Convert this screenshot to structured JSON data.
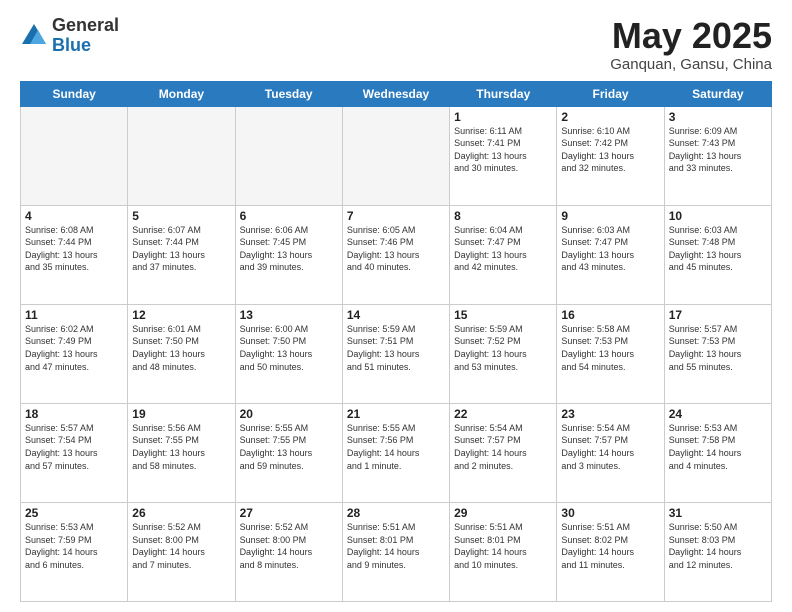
{
  "logo": {
    "general": "General",
    "blue": "Blue"
  },
  "title": "May 2025",
  "location": "Ganquan, Gansu, China",
  "days_of_week": [
    "Sunday",
    "Monday",
    "Tuesday",
    "Wednesday",
    "Thursday",
    "Friday",
    "Saturday"
  ],
  "weeks": [
    [
      {
        "day": "",
        "info": ""
      },
      {
        "day": "",
        "info": ""
      },
      {
        "day": "",
        "info": ""
      },
      {
        "day": "",
        "info": ""
      },
      {
        "day": "1",
        "info": "Sunrise: 6:11 AM\nSunset: 7:41 PM\nDaylight: 13 hours\nand 30 minutes."
      },
      {
        "day": "2",
        "info": "Sunrise: 6:10 AM\nSunset: 7:42 PM\nDaylight: 13 hours\nand 32 minutes."
      },
      {
        "day": "3",
        "info": "Sunrise: 6:09 AM\nSunset: 7:43 PM\nDaylight: 13 hours\nand 33 minutes."
      }
    ],
    [
      {
        "day": "4",
        "info": "Sunrise: 6:08 AM\nSunset: 7:44 PM\nDaylight: 13 hours\nand 35 minutes."
      },
      {
        "day": "5",
        "info": "Sunrise: 6:07 AM\nSunset: 7:44 PM\nDaylight: 13 hours\nand 37 minutes."
      },
      {
        "day": "6",
        "info": "Sunrise: 6:06 AM\nSunset: 7:45 PM\nDaylight: 13 hours\nand 39 minutes."
      },
      {
        "day": "7",
        "info": "Sunrise: 6:05 AM\nSunset: 7:46 PM\nDaylight: 13 hours\nand 40 minutes."
      },
      {
        "day": "8",
        "info": "Sunrise: 6:04 AM\nSunset: 7:47 PM\nDaylight: 13 hours\nand 42 minutes."
      },
      {
        "day": "9",
        "info": "Sunrise: 6:03 AM\nSunset: 7:47 PM\nDaylight: 13 hours\nand 43 minutes."
      },
      {
        "day": "10",
        "info": "Sunrise: 6:03 AM\nSunset: 7:48 PM\nDaylight: 13 hours\nand 45 minutes."
      }
    ],
    [
      {
        "day": "11",
        "info": "Sunrise: 6:02 AM\nSunset: 7:49 PM\nDaylight: 13 hours\nand 47 minutes."
      },
      {
        "day": "12",
        "info": "Sunrise: 6:01 AM\nSunset: 7:50 PM\nDaylight: 13 hours\nand 48 minutes."
      },
      {
        "day": "13",
        "info": "Sunrise: 6:00 AM\nSunset: 7:50 PM\nDaylight: 13 hours\nand 50 minutes."
      },
      {
        "day": "14",
        "info": "Sunrise: 5:59 AM\nSunset: 7:51 PM\nDaylight: 13 hours\nand 51 minutes."
      },
      {
        "day": "15",
        "info": "Sunrise: 5:59 AM\nSunset: 7:52 PM\nDaylight: 13 hours\nand 53 minutes."
      },
      {
        "day": "16",
        "info": "Sunrise: 5:58 AM\nSunset: 7:53 PM\nDaylight: 13 hours\nand 54 minutes."
      },
      {
        "day": "17",
        "info": "Sunrise: 5:57 AM\nSunset: 7:53 PM\nDaylight: 13 hours\nand 55 minutes."
      }
    ],
    [
      {
        "day": "18",
        "info": "Sunrise: 5:57 AM\nSunset: 7:54 PM\nDaylight: 13 hours\nand 57 minutes."
      },
      {
        "day": "19",
        "info": "Sunrise: 5:56 AM\nSunset: 7:55 PM\nDaylight: 13 hours\nand 58 minutes."
      },
      {
        "day": "20",
        "info": "Sunrise: 5:55 AM\nSunset: 7:55 PM\nDaylight: 13 hours\nand 59 minutes."
      },
      {
        "day": "21",
        "info": "Sunrise: 5:55 AM\nSunset: 7:56 PM\nDaylight: 14 hours\nand 1 minute."
      },
      {
        "day": "22",
        "info": "Sunrise: 5:54 AM\nSunset: 7:57 PM\nDaylight: 14 hours\nand 2 minutes."
      },
      {
        "day": "23",
        "info": "Sunrise: 5:54 AM\nSunset: 7:57 PM\nDaylight: 14 hours\nand 3 minutes."
      },
      {
        "day": "24",
        "info": "Sunrise: 5:53 AM\nSunset: 7:58 PM\nDaylight: 14 hours\nand 4 minutes."
      }
    ],
    [
      {
        "day": "25",
        "info": "Sunrise: 5:53 AM\nSunset: 7:59 PM\nDaylight: 14 hours\nand 6 minutes."
      },
      {
        "day": "26",
        "info": "Sunrise: 5:52 AM\nSunset: 8:00 PM\nDaylight: 14 hours\nand 7 minutes."
      },
      {
        "day": "27",
        "info": "Sunrise: 5:52 AM\nSunset: 8:00 PM\nDaylight: 14 hours\nand 8 minutes."
      },
      {
        "day": "28",
        "info": "Sunrise: 5:51 AM\nSunset: 8:01 PM\nDaylight: 14 hours\nand 9 minutes."
      },
      {
        "day": "29",
        "info": "Sunrise: 5:51 AM\nSunset: 8:01 PM\nDaylight: 14 hours\nand 10 minutes."
      },
      {
        "day": "30",
        "info": "Sunrise: 5:51 AM\nSunset: 8:02 PM\nDaylight: 14 hours\nand 11 minutes."
      },
      {
        "day": "31",
        "info": "Sunrise: 5:50 AM\nSunset: 8:03 PM\nDaylight: 14 hours\nand 12 minutes."
      }
    ]
  ]
}
